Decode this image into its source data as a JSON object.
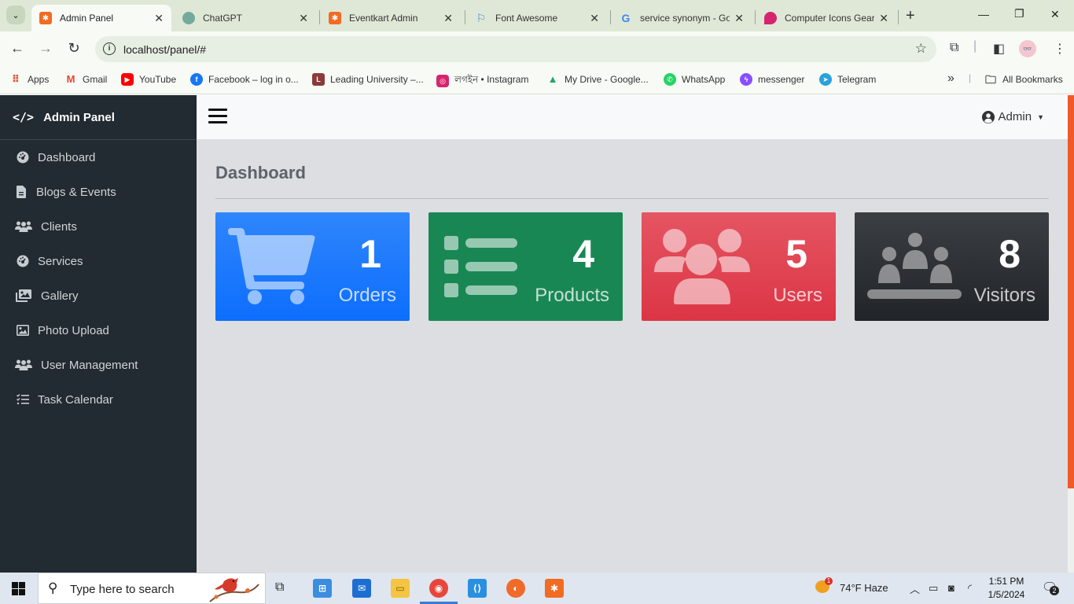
{
  "browser": {
    "tabs": [
      {
        "title": "Admin Panel",
        "active": true,
        "favicon_color": "#f26b22"
      },
      {
        "title": "ChatGPT",
        "active": false,
        "favicon_color": "#74aa9c"
      },
      {
        "title": "Eventkart Admin",
        "active": false,
        "favicon_color": "#f26b22"
      },
      {
        "title": "Font Awesome",
        "active": false,
        "favicon_color": "#4a7fd4"
      },
      {
        "title": "service synonym - Go",
        "active": false,
        "favicon_color": "#4285f4"
      },
      {
        "title": "Computer Icons Gear",
        "active": false,
        "favicon_color": "#d6246e"
      }
    ],
    "close_glyph": "✕",
    "new_tab_glyph": "+",
    "url": "localhost/panel/#",
    "bookmarks": [
      {
        "label": "Apps",
        "color": "#e0502c"
      },
      {
        "label": "Gmail",
        "color": "#ea4335"
      },
      {
        "label": "YouTube",
        "color": "#ff0000"
      },
      {
        "label": "Facebook – log in o...",
        "color": "#1877f2"
      },
      {
        "label": "Leading University –...",
        "color": "#8b3a3a"
      },
      {
        "label": "লগইন • Instagram",
        "color": "#d6246e"
      },
      {
        "label": "My Drive - Google...",
        "color": "#1fa463"
      },
      {
        "label": "WhatsApp",
        "color": "#25d366"
      },
      {
        "label": "messenger",
        "color": "#8a4dff"
      },
      {
        "label": "Telegram",
        "color": "#2aa1db"
      }
    ],
    "all_bookmarks": "All Bookmarks",
    "overflow_glyph": "»"
  },
  "sidebar": {
    "brand_icon": "</>",
    "brand": "Admin Panel",
    "items": [
      {
        "label": "Dashboard",
        "icon": "tachometer-icon"
      },
      {
        "label": "Blogs & Events",
        "icon": "file-icon"
      },
      {
        "label": "Clients",
        "icon": "users-icon"
      },
      {
        "label": "Services",
        "icon": "tachometer-icon"
      },
      {
        "label": "Gallery",
        "icon": "images-icon"
      },
      {
        "label": "Photo Upload",
        "icon": "image-icon"
      },
      {
        "label": "User Management",
        "icon": "users-icon"
      },
      {
        "label": "Task Calendar",
        "icon": "list-check-icon"
      }
    ]
  },
  "topbar": {
    "user_label": "Admin"
  },
  "main": {
    "title": "Dashboard",
    "cards": [
      {
        "value": "1",
        "label": "Orders",
        "icon": "cart-icon",
        "color": "#0d6efd"
      },
      {
        "value": "4",
        "label": "Products",
        "icon": "list-icon",
        "color": "#198754"
      },
      {
        "value": "5",
        "label": "Users",
        "icon": "users-icon",
        "color": "#dc3545"
      },
      {
        "value": "8",
        "label": "Visitors",
        "icon": "people-group-icon",
        "color": "#212529"
      }
    ]
  },
  "taskbar": {
    "search_placeholder": "Type here to search",
    "weather": "74°F  Haze",
    "weather_badge": "1",
    "time": "1:51 PM",
    "date": "1/5/2024",
    "notification_count": "2"
  }
}
